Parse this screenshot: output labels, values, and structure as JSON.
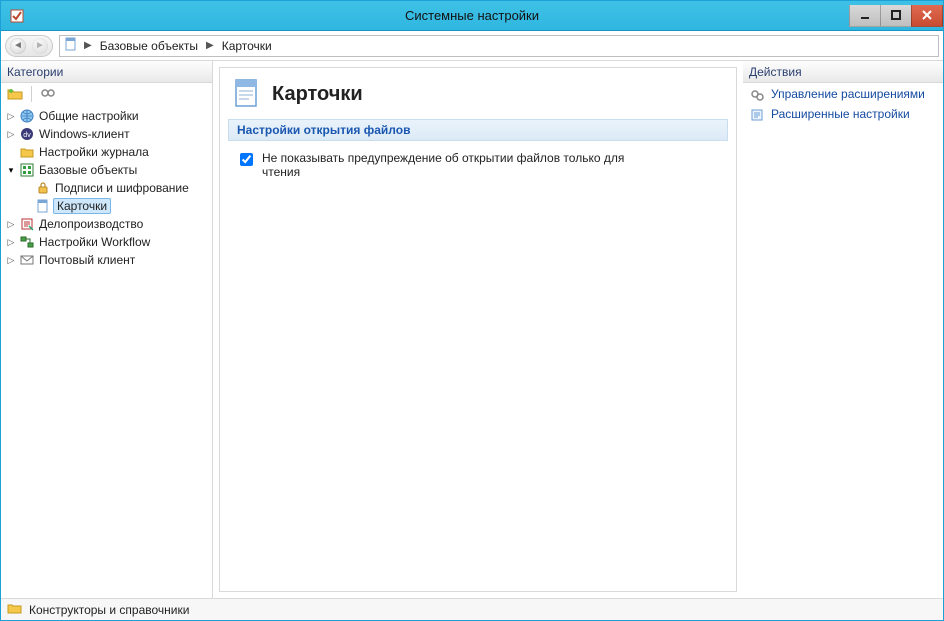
{
  "window": {
    "title": "Системные настройки"
  },
  "breadcrumb": {
    "root_icon": "document-icon",
    "items": [
      "Базовые объекты",
      "Карточки"
    ]
  },
  "left": {
    "header": "Категории",
    "tree": [
      {
        "label": "Общие настройки",
        "icon": "globe-icon",
        "expandable": true
      },
      {
        "label": "Windows-клиент",
        "icon": "dv-icon",
        "expandable": true
      },
      {
        "label": "Настройки журнала",
        "icon": "folder-icon",
        "expandable": false
      },
      {
        "label": "Базовые объекты",
        "icon": "base-icon",
        "expandable": true,
        "expanded": true,
        "children": [
          {
            "label": "Подписи и шифрование",
            "icon": "lock-icon"
          },
          {
            "label": "Карточки",
            "icon": "card-icon",
            "selected": true
          }
        ]
      },
      {
        "label": "Делопроизводство",
        "icon": "doc-mgmt-icon",
        "expandable": true
      },
      {
        "label": "Настройки Workflow",
        "icon": "workflow-icon",
        "expandable": true
      },
      {
        "label": "Почтовый клиент",
        "icon": "mail-icon",
        "expandable": true
      }
    ]
  },
  "center": {
    "title": "Карточки",
    "section_title": "Настройки открытия файлов",
    "checkbox": {
      "label": "Не показывать предупреждение об открытии файлов только для чтения",
      "checked": true
    }
  },
  "right": {
    "header": "Действия",
    "actions": [
      {
        "label": "Управление расширениями",
        "icon": "extensions-icon"
      },
      {
        "label": "Расширенные настройки",
        "icon": "adv-settings-icon"
      }
    ]
  },
  "status": {
    "label": "Конструкторы и справочники",
    "icon": "folder-icon"
  }
}
